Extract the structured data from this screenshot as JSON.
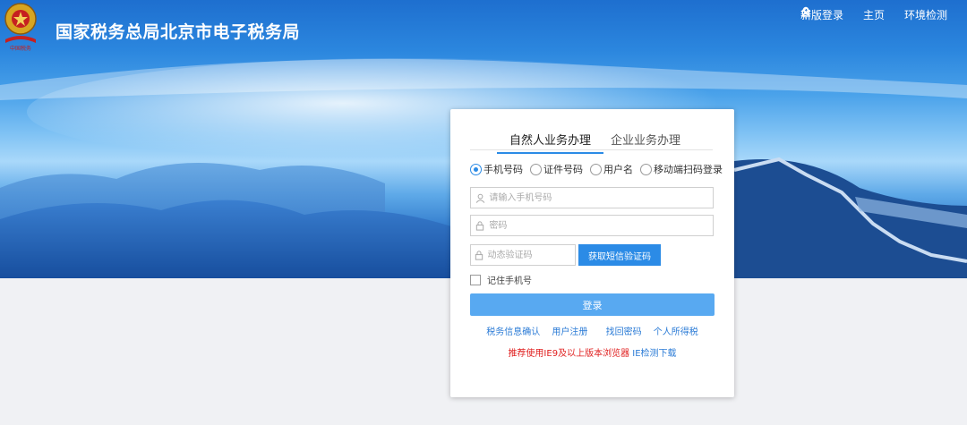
{
  "header": {
    "title": "国家税务总局北京市电子税务局",
    "logo_icon": "tax-emblem-icon",
    "nav": [
      {
        "label": "新版登录",
        "icon": "user-icon"
      },
      {
        "label": "主页",
        "icon": "home-icon"
      },
      {
        "label": "环境检测",
        "icon": "wrench-icon"
      }
    ]
  },
  "login": {
    "tabs": [
      {
        "label": "自然人业务办理",
        "active": true
      },
      {
        "label": "企业业务办理",
        "active": false
      }
    ],
    "methods": [
      {
        "label": "手机号码",
        "selected": true
      },
      {
        "label": "证件号码",
        "selected": false
      },
      {
        "label": "用户名",
        "selected": false
      },
      {
        "label": "移动端扫码登录",
        "selected": false
      }
    ],
    "phone_placeholder": "请输入手机号码",
    "password_placeholder": "密码",
    "code_placeholder": "动态验证码",
    "sms_button": "获取短信验证码",
    "remember_label": "记住手机号",
    "remember_checked": false,
    "login_button": "登录",
    "links": [
      "税务信息确认",
      "用户注册",
      "找回密码",
      "个人所得税"
    ],
    "browser_note": "推荐使用IE9及以上版本浏览器",
    "ie_check": "IE检测下载"
  },
  "colors": {
    "accent": "#2b8be6",
    "login_button": "#58a9f1",
    "warning_text": "#e02020",
    "link": "#2b7bd6"
  }
}
